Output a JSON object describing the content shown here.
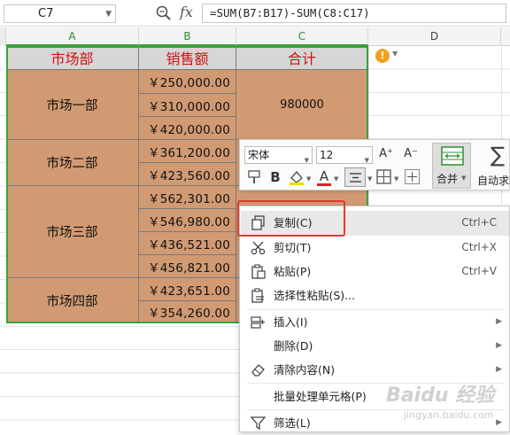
{
  "formula_bar": {
    "name_box": "C7",
    "fx_label": "fx",
    "formula": "=SUM(B7:B17)-SUM(C8:C17)"
  },
  "columns": [
    "A",
    "B",
    "C",
    "D"
  ],
  "table": {
    "headers": [
      "市场部",
      "销售额",
      "合计"
    ],
    "groups": [
      {
        "dept": "市场一部",
        "sales": [
          "￥250,000.00",
          "￥310,000.00",
          "￥420,000.00"
        ],
        "total": "980000"
      },
      {
        "dept": "市场二部",
        "sales": [
          "￥361,200.00",
          "￥423,560.00"
        ],
        "total": ""
      },
      {
        "dept": "市场三部",
        "sales": [
          "￥562,301.00",
          "￥546,980.00",
          "￥436,521.00",
          "￥456,821.00"
        ],
        "total": ""
      },
      {
        "dept": "市场四部",
        "sales": [
          "￥423,651.00",
          "￥354,260.00"
        ],
        "total": ""
      }
    ]
  },
  "mini_toolbar": {
    "font_name": "宋体",
    "font_size": "12",
    "grow_font": "A⁺",
    "shrink_font": "A⁻",
    "bold": "B",
    "font_color_letter": "A",
    "merge_label": "合并",
    "autosum_label": "自动求和",
    "accent_color": "#e02020"
  },
  "context_menu": {
    "items": [
      {
        "label": "复制(C)",
        "shortcut": "Ctrl+C",
        "icon": "copy-icon"
      },
      {
        "label": "剪切(T)",
        "shortcut": "Ctrl+X",
        "icon": "scissors-icon"
      },
      {
        "label": "粘贴(P)",
        "shortcut": "Ctrl+V",
        "icon": "paste-icon"
      },
      {
        "label": "选择性粘贴(S)...",
        "shortcut": "",
        "icon": "paste-special-icon"
      },
      {
        "label": "插入(I)",
        "shortcut": "",
        "icon": "insert-icon"
      },
      {
        "label": "删除(D)",
        "shortcut": "",
        "icon": ""
      },
      {
        "label": "清除内容(N)",
        "shortcut": "",
        "icon": "eraser-icon"
      },
      {
        "label": "批量处理单元格(P)",
        "shortcut": "",
        "icon": ""
      },
      {
        "label": "筛选(L)",
        "shortcut": "",
        "icon": "filter-icon"
      }
    ],
    "highlight_color": "#e23a2a"
  },
  "watermark": {
    "text": "Baidu 经验",
    "sub": "jingyan.baidu.com"
  }
}
